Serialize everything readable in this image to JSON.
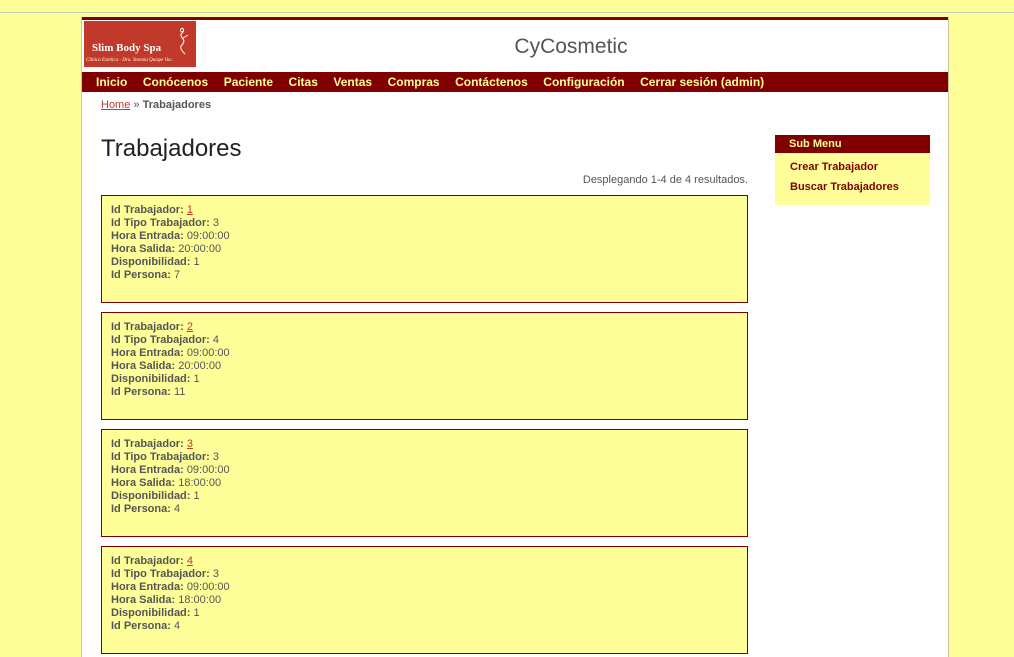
{
  "logo": {
    "name": "Slim Body Spa",
    "subtitle": "Clínica Estética - Dra. Yesenia Quispe Vac."
  },
  "site_title": "CyCosmetic",
  "menu": [
    "Inicio",
    "Conócenos",
    "Paciente",
    "Citas",
    "Ventas",
    "Compras",
    "Contáctenos",
    "Configuración",
    "Cerrar sesión (admin)"
  ],
  "breadcrumb": {
    "home": "Home",
    "separator": "»",
    "current": "Trabajadores"
  },
  "page_title": "Trabajadores",
  "summary": "Desplegando 1-4 de 4 resultados.",
  "labels": {
    "id_trabajador": "Id Trabajador:",
    "id_tipo": "Id Tipo Trabajador:",
    "hora_entrada": "Hora Entrada:",
    "hora_salida": "Hora Salida:",
    "disponibilidad": "Disponibilidad:",
    "id_persona": "Id Persona:"
  },
  "records": [
    {
      "id_trabajador": "1",
      "id_tipo": "3",
      "hora_entrada": "09:00:00",
      "hora_salida": "20:00:00",
      "disponibilidad": "1",
      "id_persona": "7"
    },
    {
      "id_trabajador": "2",
      "id_tipo": "4",
      "hora_entrada": "09:00:00",
      "hora_salida": "20:00:00",
      "disponibilidad": "1",
      "id_persona": "11"
    },
    {
      "id_trabajador": "3",
      "id_tipo": "3",
      "hora_entrada": "09:00:00",
      "hora_salida": "18:00:00",
      "disponibilidad": "1",
      "id_persona": "4"
    },
    {
      "id_trabajador": "4",
      "id_tipo": "3",
      "hora_entrada": "09:00:00",
      "hora_salida": "18:00:00",
      "disponibilidad": "1",
      "id_persona": "4"
    }
  ],
  "sidebar": {
    "title": "Sub Menu",
    "items": [
      "Crear Trabajador",
      "Buscar Trabajadores"
    ]
  },
  "colors": {
    "background": "#ffff99",
    "accent": "#800000",
    "link": "#c0392b"
  }
}
